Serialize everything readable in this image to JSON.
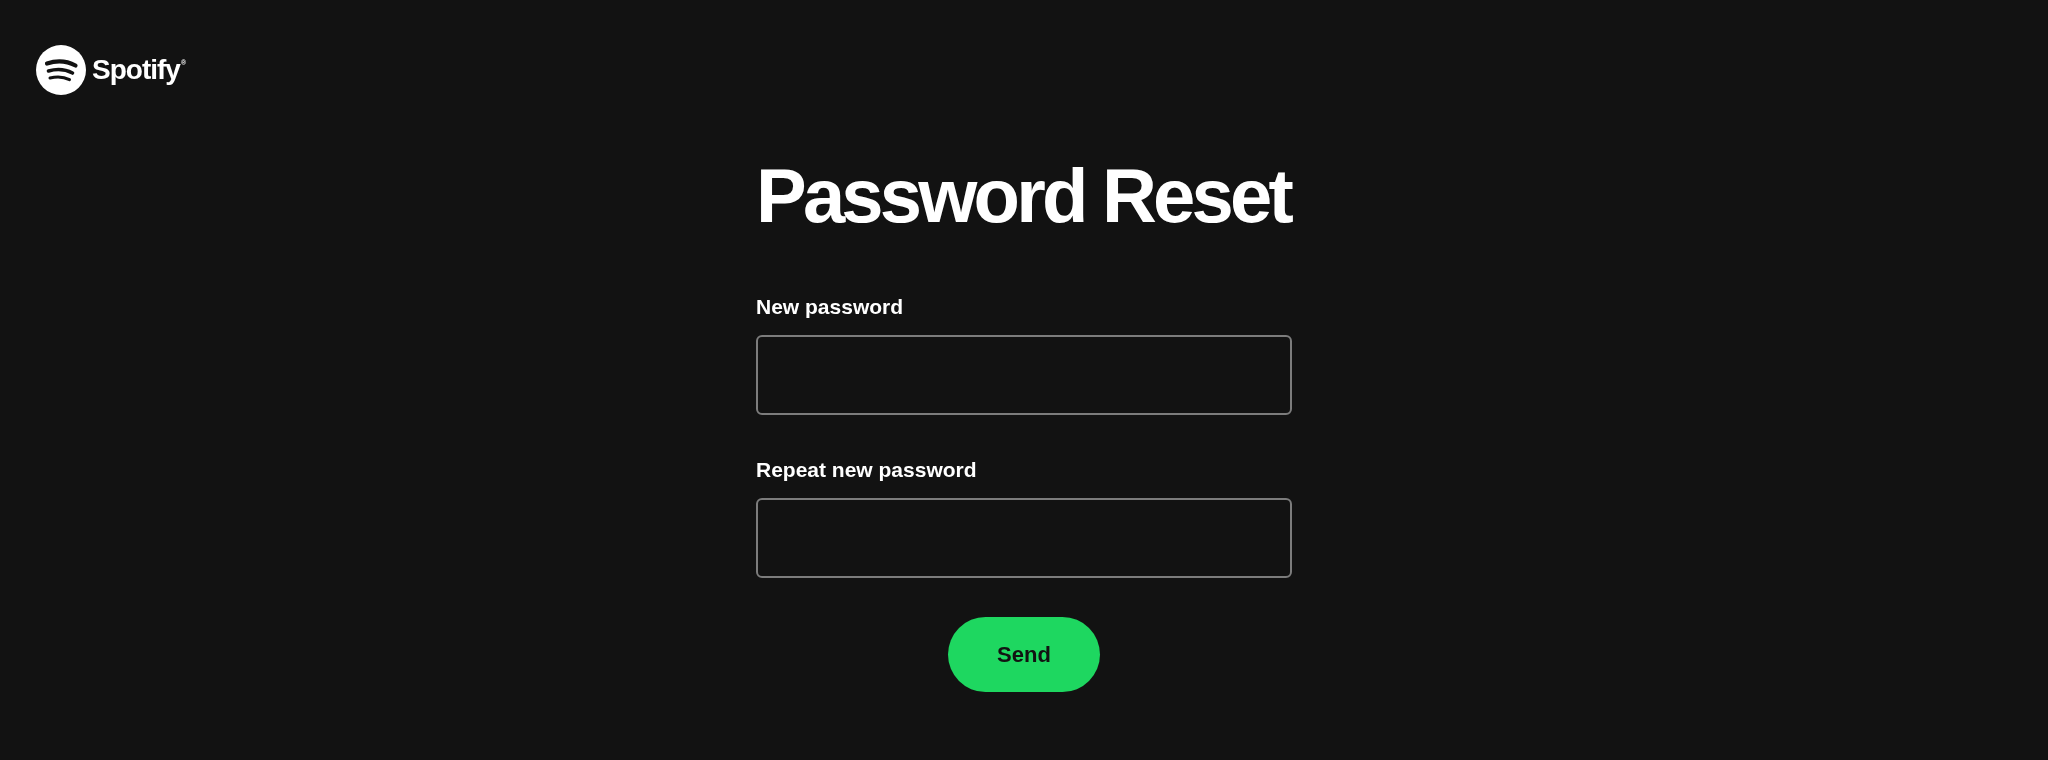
{
  "header": {
    "logo_text": "Spotify$^{®}$"
  },
  "title": "Password Reset",
  "fields": [
    {
      "label": "New password"
    },
    {
      "label": "Repeat new password"
    }
  ],
  "submit_button": {
    "label": "Send"
  }
}
